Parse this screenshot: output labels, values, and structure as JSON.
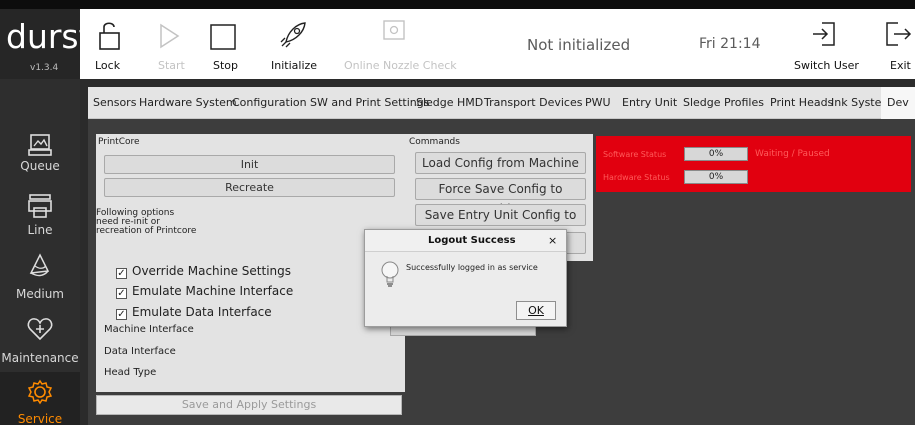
{
  "app": {
    "logo": "durst",
    "version": "v1.3.4"
  },
  "toolbar": {
    "lock": "Lock",
    "start": "Start",
    "stop": "Stop",
    "initialize": "Initialize",
    "online_nozzle_check": "Online Nozzle Check",
    "status": "Not initialized",
    "clock": "Fri 21:14",
    "switch_user": "Switch User",
    "exit": "Exit"
  },
  "sidebar": {
    "items": [
      {
        "label": "Queue",
        "icon": "queue-icon"
      },
      {
        "label": "Line",
        "icon": "printer-icon"
      },
      {
        "label": "Medium",
        "icon": "medium-icon"
      },
      {
        "label": "Maintenance",
        "icon": "maintenance-icon"
      },
      {
        "label": "Service",
        "icon": "gear-icon"
      }
    ]
  },
  "tabs": [
    "Sensors",
    "Hardware System",
    "Configuration",
    "SW and Print Settings",
    "Sledge HMD",
    "Transport Devices",
    "PWU",
    "Entry Unit",
    "Sledge Profiles",
    "Print Heads",
    "Ink System",
    "Dev"
  ],
  "printcore": {
    "title": "PrintCore",
    "init": "Init",
    "recreate": "Recreate",
    "note_1": "Following options",
    "note_2": "need re-init or",
    "note_3": "recreation of Printcore",
    "override": "Override Machine Settings",
    "emulate_machine": "Emulate Machine Interface",
    "emulate_data": "Emulate Data Interface",
    "machine_interface": "Machine Interface",
    "data_interface": "Data Interface",
    "head_type": "Head Type",
    "save_apply": "Save and Apply Settings"
  },
  "commands": {
    "title": "Commands",
    "load_config": "Load Config from Machine",
    "force_save": "Force Save Config to Machine",
    "save_entry": "Save Entry Unit Config to File"
  },
  "status_panel": {
    "software_label": "Software Status",
    "software_value": "0%",
    "software_state": "Waiting / Paused",
    "hardware_label": "Hardware Status",
    "hardware_value": "0%",
    "color": "#e1000f"
  },
  "dialog": {
    "title": "Logout Success",
    "close": "×",
    "message": "Successfully logged in as service",
    "ok": "OK",
    "icon": "lightbulb-icon"
  }
}
